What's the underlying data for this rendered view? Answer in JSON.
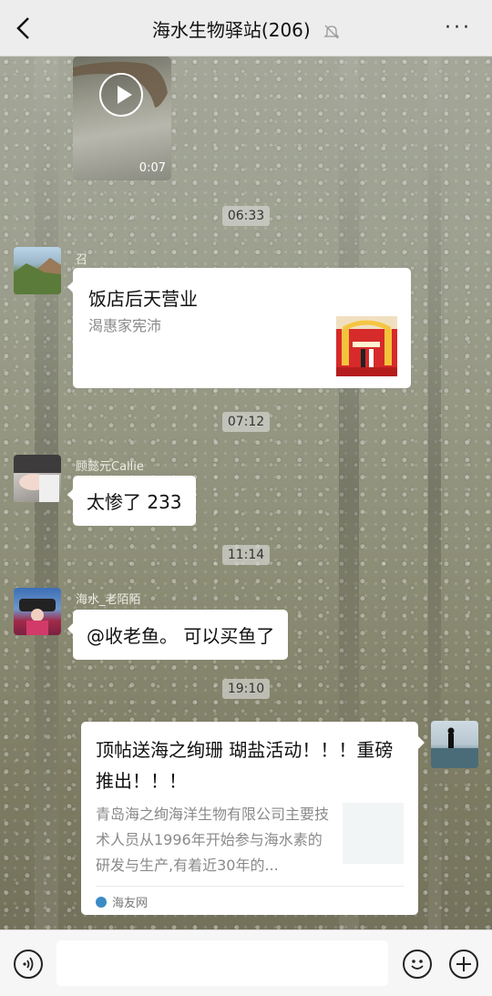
{
  "header": {
    "title": "海水生物驿站(206)",
    "more_label": "···"
  },
  "messages": {
    "video": {
      "duration": "0:07"
    },
    "time1": "06:33",
    "m1": {
      "sender": "召",
      "title": "饭店后天营业",
      "subtitle": "渴惠家宪沛"
    },
    "time2": "07:12",
    "m2": {
      "sender": "顾懿元Callie",
      "text": "太惨了 233"
    },
    "time3": "11:14",
    "m3": {
      "sender": "海水_老陌陌",
      "text": "@收老鱼。 可以买鱼了"
    },
    "time4": "19:10",
    "m4": {
      "title": "顶帖送海之绚珊 瑚盐活动！！！重磅推出！！！",
      "desc": "青岛海之绚海洋生物有限公司主要技术人员从1996年开始参与海水素的研发与生产,有着近30年的...",
      "source": "海友网"
    }
  },
  "colors": {
    "bubble": "#ffffff",
    "topbar": "#ededed",
    "bottombar": "#f6f6f6",
    "source_dot": "#3b8bc4"
  },
  "icons": [
    "back-arrow-icon",
    "mute-bell-icon",
    "more-icon",
    "play-icon",
    "voice-icon",
    "emoji-icon",
    "plus-icon"
  ]
}
